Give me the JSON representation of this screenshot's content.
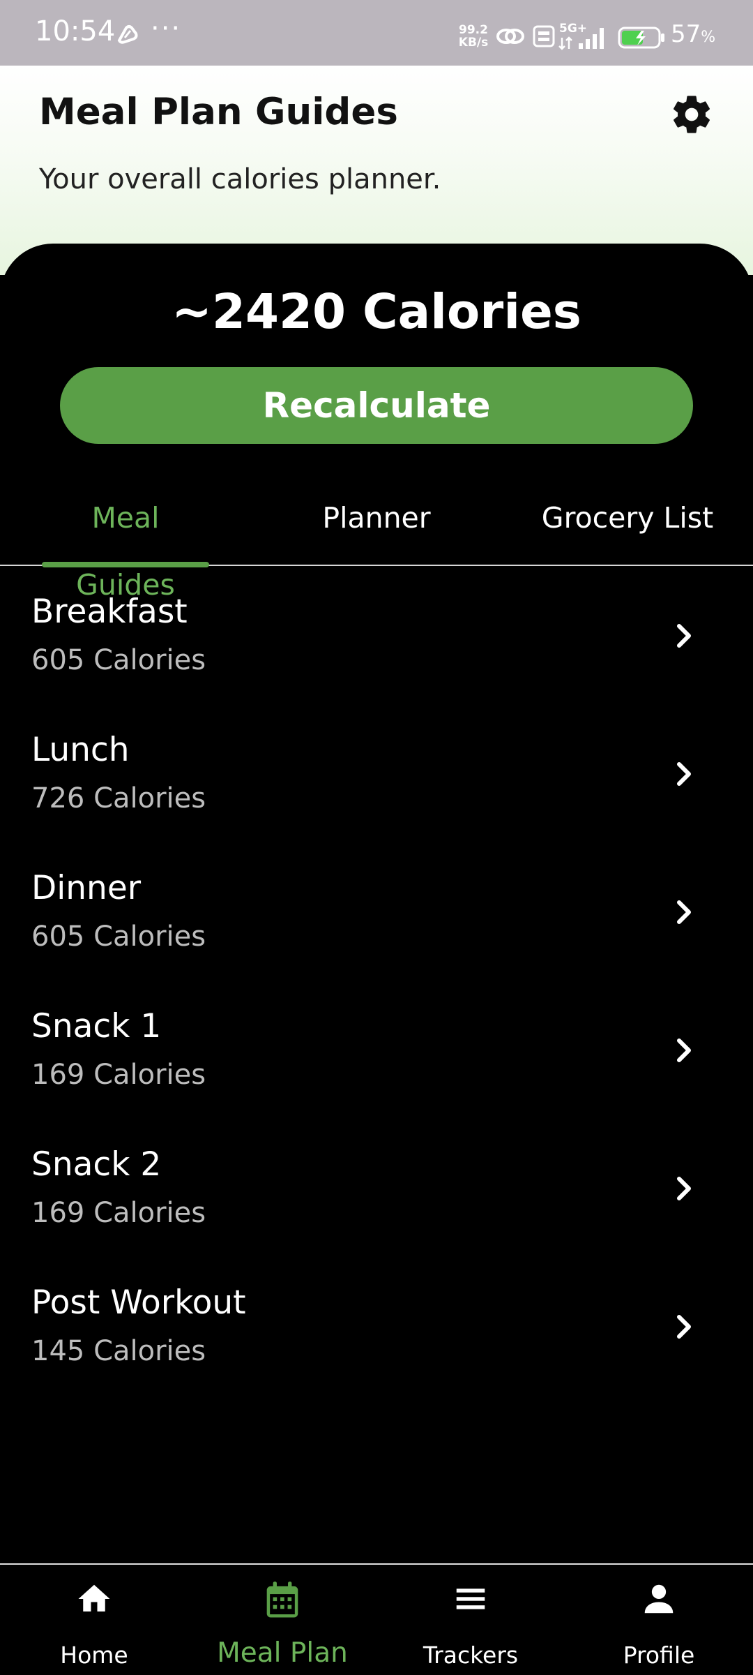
{
  "status_bar": {
    "time": "10:54",
    "dots": "···",
    "net_speed_value": "99.2",
    "net_speed_unit": "KB/s",
    "battery_percent": "57",
    "battery_unit": "%"
  },
  "header": {
    "title": "Meal Plan Guides",
    "subtitle": "Your overall calories planner.",
    "settings_icon": "gear-icon"
  },
  "summary": {
    "total_calories": "~2420 Calories",
    "recalculate_label": "Recalculate",
    "accent_color": "#5a9f47"
  },
  "tabs": [
    {
      "label": "Meal Guides",
      "active": true
    },
    {
      "label": "Planner",
      "active": false
    },
    {
      "label": "Grocery List",
      "active": false
    }
  ],
  "meals": [
    {
      "name": "Breakfast",
      "calories": "605 Calories"
    },
    {
      "name": "Lunch",
      "calories": "726 Calories"
    },
    {
      "name": "Dinner",
      "calories": "605 Calories"
    },
    {
      "name": "Snack 1",
      "calories": "169 Calories"
    },
    {
      "name": "Snack 2",
      "calories": "169 Calories"
    },
    {
      "name": "Post Workout",
      "calories": "145 Calories"
    }
  ],
  "bottom_nav": [
    {
      "label": "Home",
      "icon": "home-icon",
      "active": false
    },
    {
      "label": "Meal Plan",
      "icon": "calendar-icon",
      "active": true
    },
    {
      "label": "Trackers",
      "icon": "menu-icon",
      "active": false
    },
    {
      "label": "Profile",
      "icon": "person-icon",
      "active": false
    }
  ]
}
